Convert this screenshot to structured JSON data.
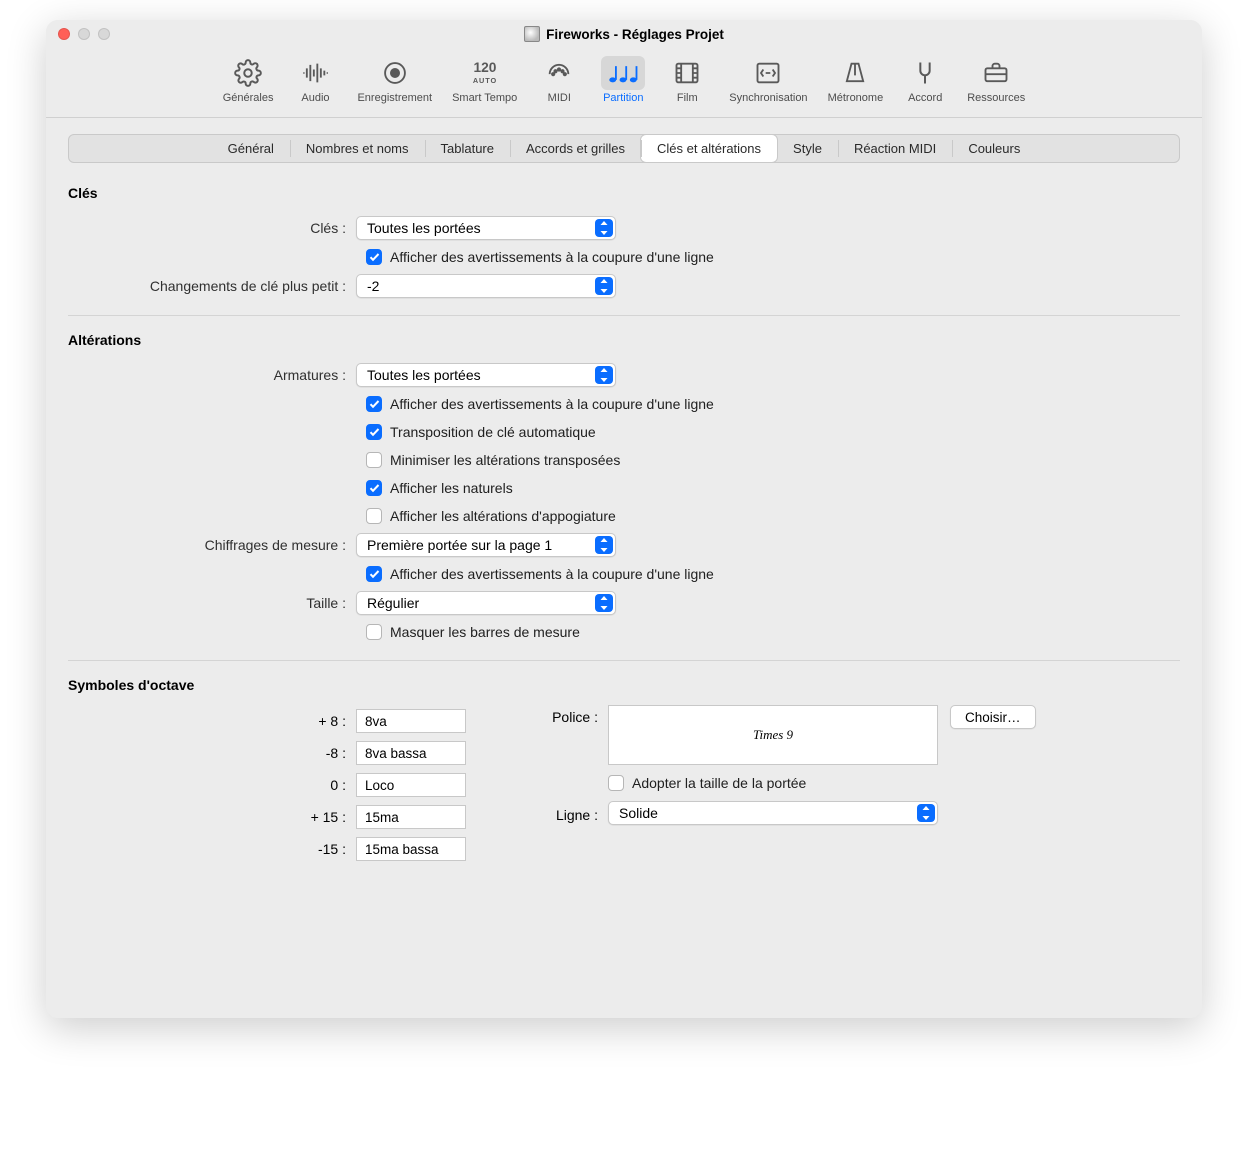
{
  "window": {
    "title": "Fireworks - Réglages Projet"
  },
  "toolbar": [
    {
      "id": "general",
      "label": "Générales",
      "active": false
    },
    {
      "id": "audio",
      "label": "Audio",
      "active": false
    },
    {
      "id": "recording",
      "label": "Enregistrement",
      "active": false
    },
    {
      "id": "smarttempo",
      "label": "Smart Tempo",
      "active": false
    },
    {
      "id": "midi",
      "label": "MIDI",
      "active": false
    },
    {
      "id": "partition",
      "label": "Partition",
      "active": true
    },
    {
      "id": "film",
      "label": "Film",
      "active": false
    },
    {
      "id": "sync",
      "label": "Synchronisation",
      "active": false
    },
    {
      "id": "metronome",
      "label": "Métronome",
      "active": false
    },
    {
      "id": "chord",
      "label": "Accord",
      "active": false
    },
    {
      "id": "resources",
      "label": "Ressources",
      "active": false
    }
  ],
  "subtabs": [
    {
      "id": "general",
      "label": "Général",
      "active": false
    },
    {
      "id": "numbers",
      "label": "Nombres et noms",
      "active": false
    },
    {
      "id": "tablature",
      "label": "Tablature",
      "active": false
    },
    {
      "id": "chords",
      "label": "Accords et grilles",
      "active": false
    },
    {
      "id": "clefs",
      "label": "Clés et altérations",
      "active": true
    },
    {
      "id": "style",
      "label": "Style",
      "active": false
    },
    {
      "id": "midireact",
      "label": "Réaction MIDI",
      "active": false
    },
    {
      "id": "colors",
      "label": "Couleurs",
      "active": false
    }
  ],
  "sections": {
    "clefs": {
      "heading": "Clés",
      "clefs_label": "Clés :",
      "clefs_value": "Toutes les portées",
      "warnings_label": "Afficher des avertissements à la coupure d'une ligne",
      "warnings_checked": true,
      "smaller_label": "Changements de clé plus petit :",
      "smaller_value": "-2"
    },
    "alterations": {
      "heading": "Altérations",
      "armatures_label": "Armatures :",
      "armatures_value": "Toutes les portées",
      "warn1_label": "Afficher des avertissements à la coupure d'une ligne",
      "warn1_checked": true,
      "transpose_label": "Transposition de clé automatique",
      "transpose_checked": true,
      "minimize_label": "Minimiser les altérations transposées",
      "minimize_checked": false,
      "naturals_label": "Afficher les naturels",
      "naturals_checked": true,
      "appog_label": "Afficher les altérations d'appogiature",
      "appog_checked": false,
      "timesig_label": "Chiffrages de mesure :",
      "timesig_value": "Première portée sur la page 1",
      "warn2_label": "Afficher des avertissements à la coupure d'une ligne",
      "warn2_checked": true,
      "size_label": "Taille :",
      "size_value": "Régulier",
      "hide_barline_label": "Masquer les barres de mesure",
      "hide_barline_checked": false
    },
    "octave": {
      "heading": "Symboles d'octave",
      "plus8_label": "+ 8 :",
      "plus8_value": "8va",
      "minus8_label": "-8 :",
      "minus8_value": "8va bassa",
      "zero_label": "0 :",
      "zero_value": "Loco",
      "plus15_label": "+ 15 :",
      "plus15_value": "15ma",
      "minus15_label": "-15 :",
      "minus15_value": "15ma bassa",
      "font_label": "Police :",
      "font_preview": "Times 9",
      "choose_btn": "Choisir…",
      "adopt_label": "Adopter la taille de la portée",
      "adopt_checked": false,
      "line_label": "Ligne :",
      "line_value": "Solide"
    }
  }
}
